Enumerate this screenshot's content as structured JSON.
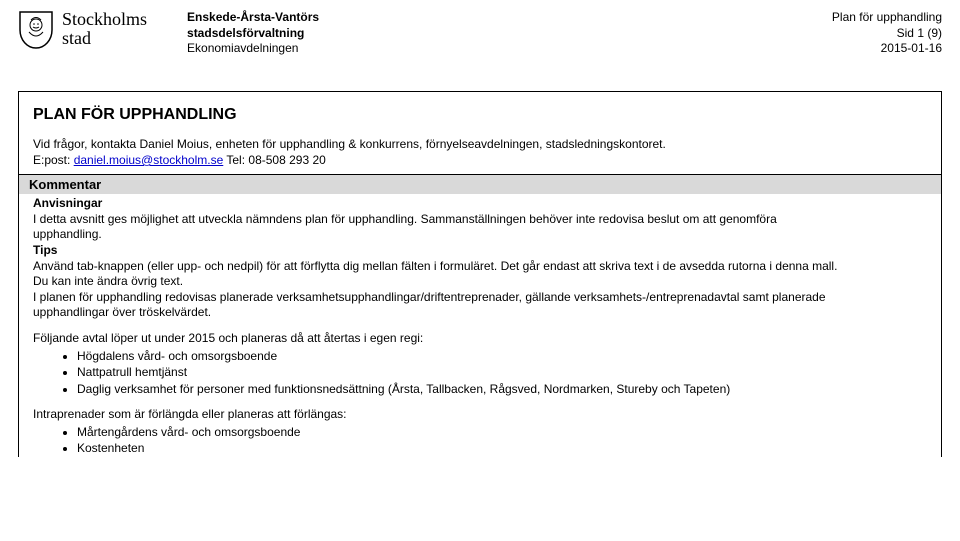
{
  "header": {
    "logo_line1": "Stockholms",
    "logo_line2": "stad",
    "org_line1": "Enskede-Årsta-Vantörs",
    "org_line2": "stadsdelsförvaltning",
    "org_line3": "Ekonomiavdelningen",
    "right_line1": "Plan för upphandling",
    "right_line2": "Sid 1 (9)",
    "right_line3": "2015-01-16"
  },
  "title": "PLAN FÖR UPPHANDLING",
  "intro": {
    "line1": "Vid frågor, kontakta Daniel Moius, enheten för upphandling & konkurrens, förnyelseavdelningen, stadsledningskontoret.",
    "email_label": "E:post: ",
    "email": "daniel.moius@stockholm.se",
    "tel": " Tel: 08-508 293 20"
  },
  "comment_label": "Kommentar",
  "advice": {
    "heading": "Anvisningar",
    "p1a": "I detta avsnitt ges möjlighet att utveckla nämndens plan för upphandling. Sammanställningen behöver inte redovisa beslut om att genomföra",
    "p1b": "upphandling.",
    "tips_heading": "Tips",
    "p2a": "Använd tab-knappen (eller upp- och nedpil) för att förflytta dig mellan fälten i formuläret. Det går endast att skriva text i de avsedda rutorna i denna mall.",
    "p2b": "Du kan inte ändra övrig text.",
    "p3a": "I planen för upphandling redovisas planerade verksamhetsupphandlingar/driftentreprenader, gällande verksamhets-/entreprenadavtal samt planerade",
    "p3b": "upphandlingar över tröskelvärdet."
  },
  "list1": {
    "intro": "Följande avtal löper ut under 2015 och planeras då att återtas i egen regi:",
    "items": [
      "Högdalens vård- och omsorgsboende",
      "Nattpatrull hemtjänst",
      "Daglig verksamhet för personer med funktionsnedsättning (Årsta, Tallbacken, Rågsved, Nordmarken, Stureby och Tapeten)"
    ]
  },
  "list2": {
    "intro": "Intraprenader som är förlängda eller planeras att förlängas:",
    "items": [
      "Mårtengårdens vård- och omsorgsboende",
      "Kostenheten"
    ]
  }
}
